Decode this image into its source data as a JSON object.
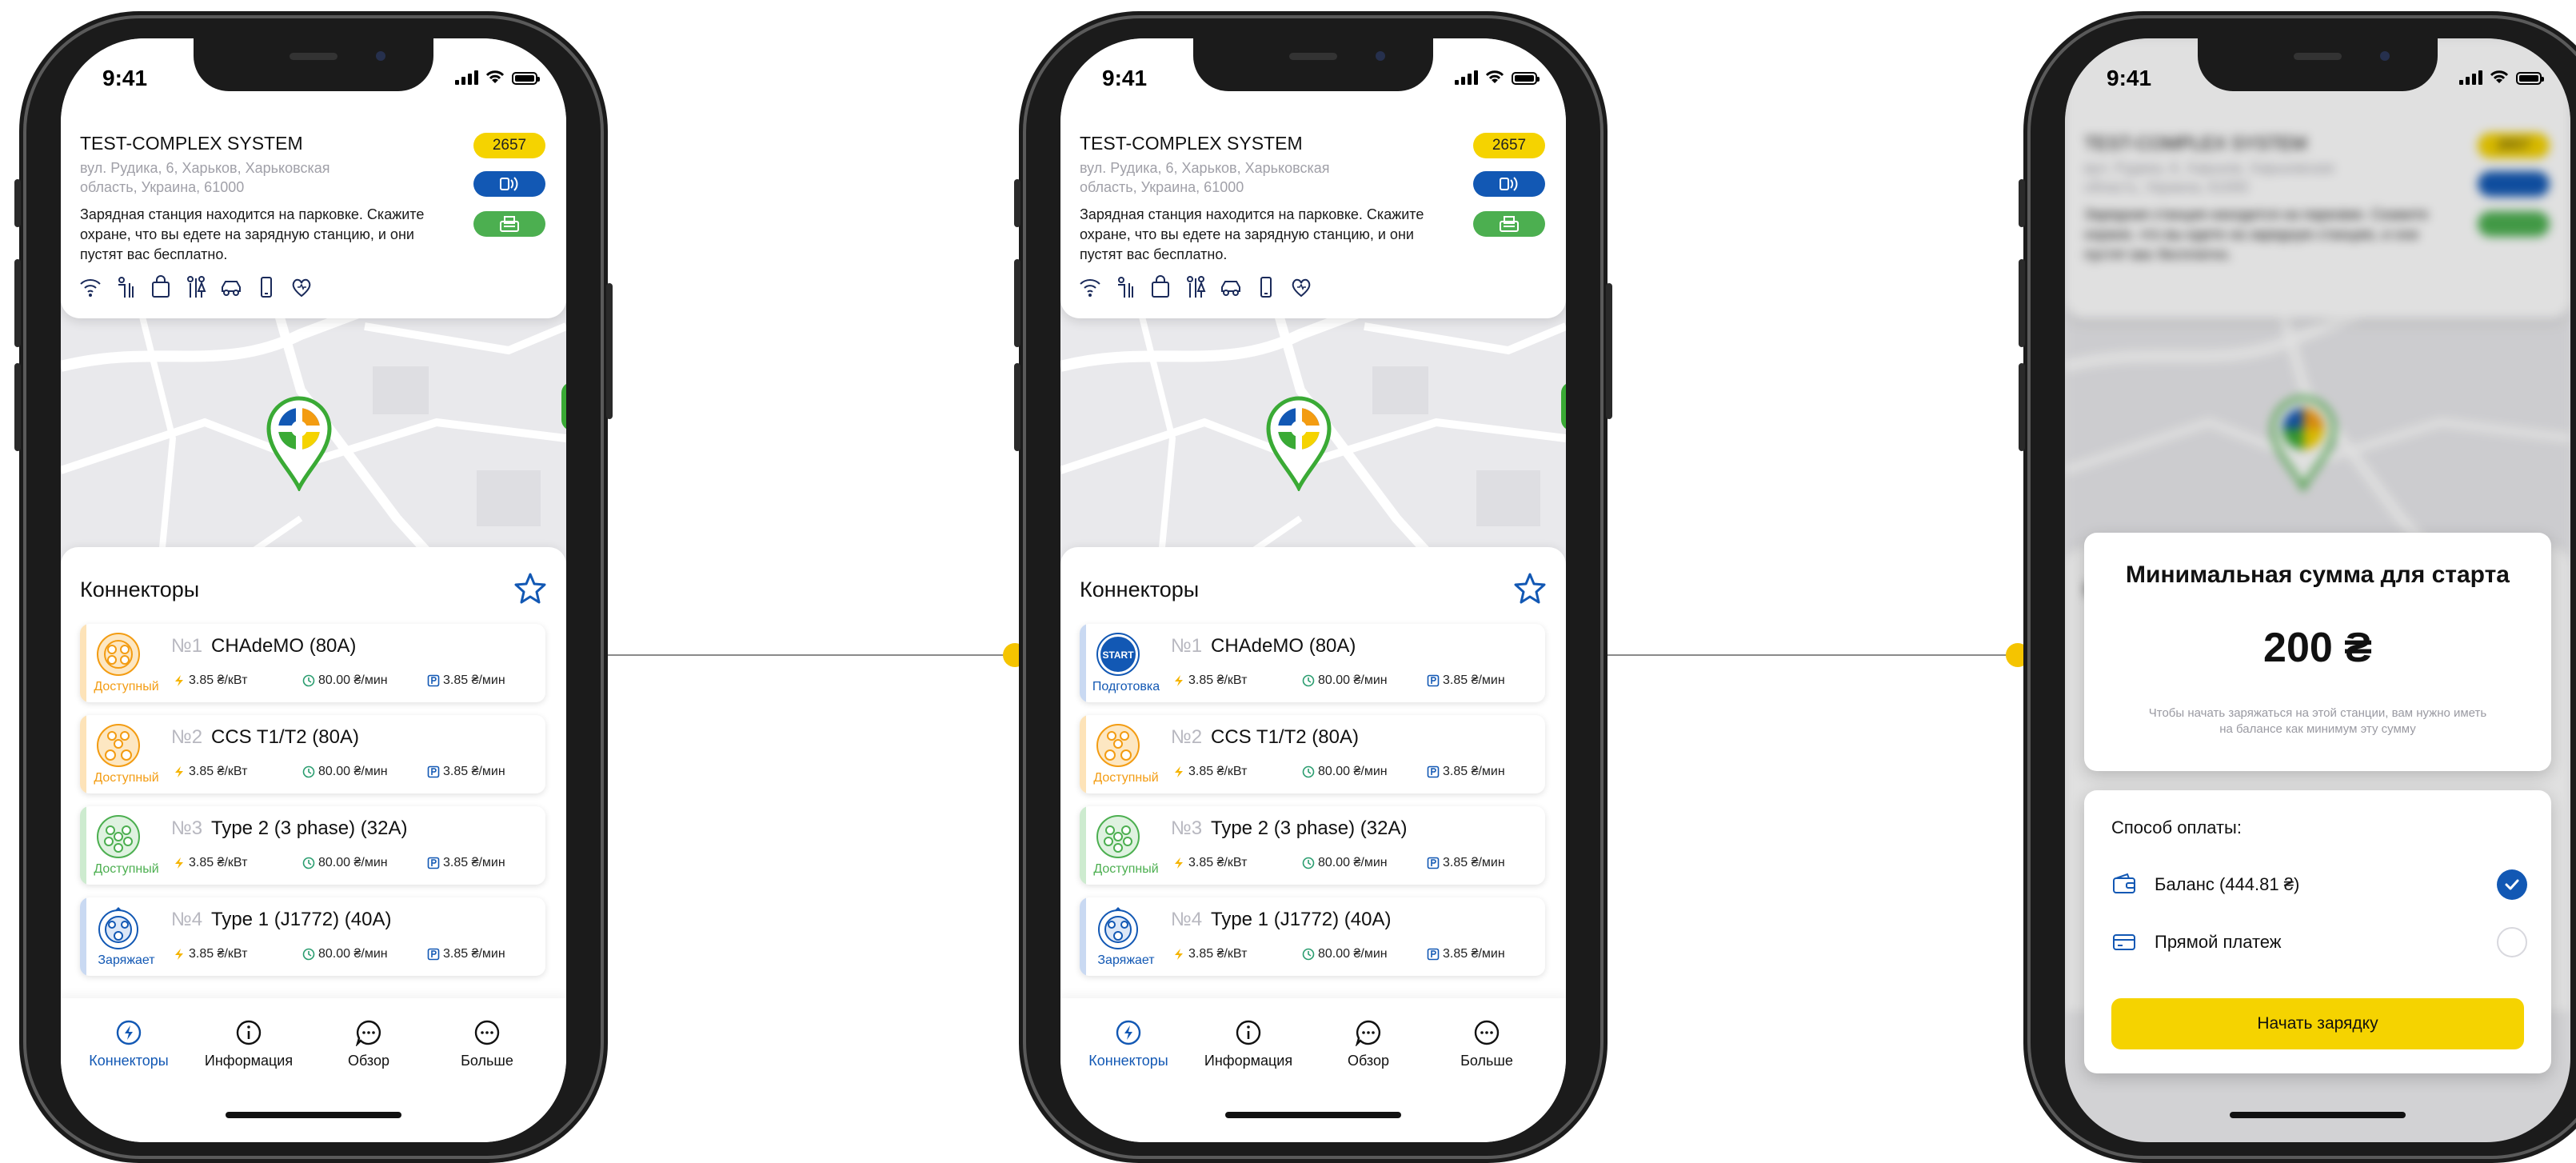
{
  "colors": {
    "brand_blue": "#1258b4",
    "brand_yellow": "#f5d300",
    "available_orange": "#f39c12",
    "available_green": "#4caf50",
    "charging_blue": "#1258b4",
    "connector_line": "#8a8a8a"
  },
  "status_bar": {
    "time": "9:41"
  },
  "station": {
    "name": "TEST-COMPLEX SYSTEM",
    "address": "вул. Рудика, 6, Харьков, Харьковская область, Украина, 61000",
    "description": "Зарядная станция находится на парковке. Скажите охране, что вы едете на зарядную станцию, и они пустят вас бесплатно.",
    "badge_id": "2657",
    "amenities": [
      "wifi-icon",
      "restroom-icon",
      "shopping-bag-icon",
      "toilet-icon",
      "car-icon",
      "phone-icon",
      "heart-icon"
    ]
  },
  "connectors_panel": {
    "title": "Коннекторы"
  },
  "screens": [
    {
      "connectors": [
        {
          "number": "№1",
          "name": "CHAdeMO (80A)",
          "status": "Доступный",
          "status_color": "#f39c12",
          "icon": "chademo-icon",
          "price_kwh": "3.85 ₴/кВт",
          "price_min": "80.00 ₴/мин",
          "price_parking": "3.85 ₴/мин"
        },
        {
          "number": "№2",
          "name": "CCS T1/T2 (80A)",
          "status": "Доступный",
          "status_color": "#f39c12",
          "icon": "ccs-icon",
          "price_kwh": "3.85 ₴/кВт",
          "price_min": "80.00 ₴/мин",
          "price_parking": "3.85 ₴/мин"
        },
        {
          "number": "№3",
          "name": "Type 2 (3 phase) (32A)",
          "status": "Доступный",
          "status_color": "#4caf50",
          "icon": "type2-icon",
          "price_kwh": "3.85 ₴/кВт",
          "price_min": "80.00 ₴/мин",
          "price_parking": "3.85 ₴/мин"
        },
        {
          "number": "№4",
          "name": "Type 1 (J1772) (40A)",
          "status": "Заряжает",
          "status_color": "#1258b4",
          "icon": "type1-icon",
          "price_kwh": "3.85 ₴/кВт",
          "price_min": "80.00 ₴/мин",
          "price_parking": "3.85 ₴/мин"
        }
      ]
    },
    {
      "connectors": [
        {
          "number": "№1",
          "name": "CHAdeMO (80A)",
          "status": "Подготовка",
          "status_color": "#1258b4",
          "icon": "start-icon",
          "start_label": "START",
          "price_kwh": "3.85 ₴/кВт",
          "price_min": "80.00 ₴/мин",
          "price_parking": "3.85 ₴/мин"
        },
        {
          "number": "№2",
          "name": "CCS T1/T2 (80A)",
          "status": "Доступный",
          "status_color": "#f39c12",
          "icon": "ccs-icon",
          "price_kwh": "3.85 ₴/кВт",
          "price_min": "80.00 ₴/мин",
          "price_parking": "3.85 ₴/мин"
        },
        {
          "number": "№3",
          "name": "Type 2 (3 phase) (32A)",
          "status": "Доступный",
          "status_color": "#4caf50",
          "icon": "type2-icon",
          "price_kwh": "3.85 ₴/кВт",
          "price_min": "80.00 ₴/мин",
          "price_parking": "3.85 ₴/мин"
        },
        {
          "number": "№4",
          "name": "Type 1 (J1772) (40A)",
          "status": "Заряжает",
          "status_color": "#1258b4",
          "icon": "type1-icon",
          "price_kwh": "3.85 ₴/кВт",
          "price_min": "80.00 ₴/мин",
          "price_parking": "3.85 ₴/мин"
        }
      ]
    }
  ],
  "tabs": [
    {
      "label": "Коннекторы",
      "icon": "lightning-icon",
      "active": true
    },
    {
      "label": "Информация",
      "icon": "info-icon",
      "active": false
    },
    {
      "label": "Обзор",
      "icon": "chat-icon",
      "active": false
    },
    {
      "label": "Больше",
      "icon": "more-icon",
      "active": false
    }
  ],
  "payment_modal": {
    "title": "Минимальная сумма для старта",
    "amount": "200 ₴",
    "note": "Чтобы начать заряжаться на этой станции, вам нужно иметь на балансе как минимум эту сумму",
    "method_label": "Способ оплаты:",
    "methods": [
      {
        "label": "Баланс (444.81 ₴)",
        "icon": "wallet-icon",
        "selected": true
      },
      {
        "label": "Прямой платеж",
        "icon": "credit-card-icon",
        "selected": false
      }
    ],
    "start_button": "Начать зарядку"
  }
}
